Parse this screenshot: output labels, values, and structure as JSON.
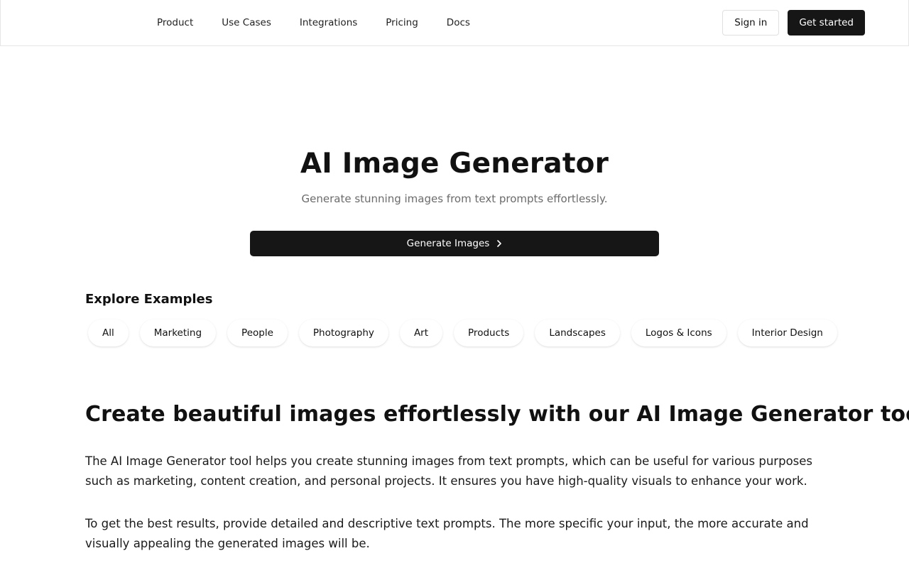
{
  "header": {
    "nav": [
      "Product",
      "Use Cases",
      "Integrations",
      "Pricing",
      "Docs"
    ],
    "sign_in": "Sign in",
    "get_started": "Get started"
  },
  "hero": {
    "title": "AI Image Generator",
    "subtitle": "Generate stunning images from text prompts effortlessly.",
    "cta": "Generate Images",
    "cta_icon": "chevron-right-icon"
  },
  "explore": {
    "title": "Explore Examples",
    "categories": [
      "All",
      "Marketing",
      "People",
      "Photography",
      "Art",
      "Products",
      "Landscapes",
      "Logos & Icons",
      "Interior Design"
    ]
  },
  "content": {
    "title": "Create beautiful images effortlessly with our AI Image Generator tool",
    "paragraphs": [
      "The AI Image Generator tool helps you create stunning images from text prompts, which can be useful for various purposes such as marketing, content creation, and personal projects. It ensures you have high-quality visuals to enhance your work.",
      "To get the best results, provide detailed and descriptive text prompts. The more specific your input, the more accurate and visually appealing the generated images will be."
    ]
  },
  "colors": {
    "primary_dark": "#161616",
    "muted_text": "#6b6b6b",
    "border": "#e5e5e5"
  }
}
